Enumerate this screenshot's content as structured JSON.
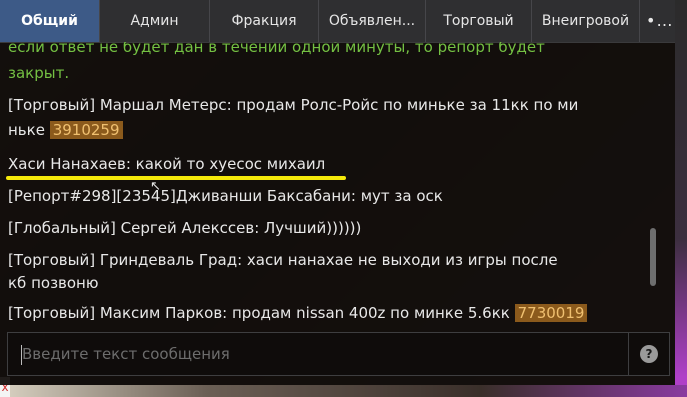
{
  "tabs": [
    {
      "label": "Общий",
      "active": true
    },
    {
      "label": "Админ",
      "active": false
    },
    {
      "label": "Фракция",
      "active": false
    },
    {
      "label": "Объявлен...",
      "active": false
    },
    {
      "label": "Торговый",
      "active": false
    },
    {
      "label": "Внеигровой",
      "active": false
    }
  ],
  "more_label": "•••",
  "messages": [
    {
      "text": "если ответ не будет дан в течении одной минуты, то репорт будет",
      "kind": "system"
    },
    {
      "text": "закрыт.",
      "kind": "system"
    },
    {
      "text": "[Торговый] Маршал Метерс: продам Ролс-Ройс по миньке за 11кк по ми",
      "kind": "normal"
    },
    {
      "text": "ньке",
      "badge": "3910259",
      "kind": "normal"
    },
    {
      "text": "Хаси Нанахаев: какой то хуесос михаил",
      "kind": "normal"
    },
    {
      "text": "[Репорт#298][23545]Дживанши Баксабани: мут за оск",
      "kind": "normal"
    },
    {
      "text": "[Глобальный] Сергей Алекссев: Лучший))))))",
      "kind": "normal"
    },
    {
      "text": "[Торговый] Гриндеваль Град: хаси нанахае не выходи из игры после",
      "kind": "normal"
    },
    {
      "text": "кб позвоню",
      "kind": "normal"
    },
    {
      "text": "[Торговый] Максим Парков: продам nissan 400z  по минке 5.6кк",
      "badge": "7730019",
      "kind": "normal"
    }
  ],
  "input": {
    "placeholder": "Введите текст сообщения",
    "value": ""
  },
  "help_label": "?",
  "colors": {
    "active_tab": "#3d5a87",
    "system_text": "#74c043",
    "badge_bg": "#8b5a1c",
    "highlight": "#f5e90a"
  }
}
